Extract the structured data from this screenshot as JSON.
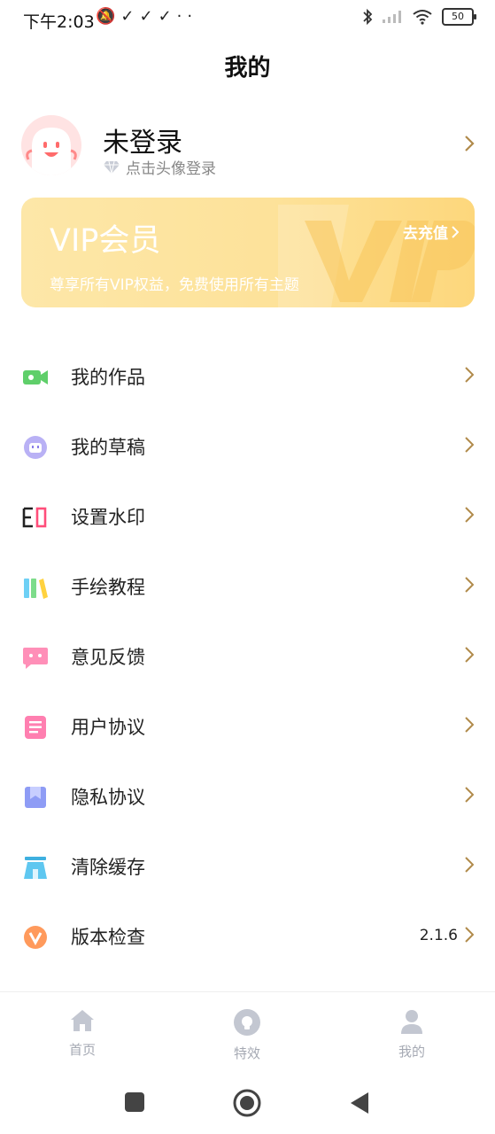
{
  "status_bar": {
    "time": "下午2:03",
    "battery": "50"
  },
  "page": {
    "title": "我的"
  },
  "profile": {
    "name": "未登录",
    "subtitle": "点击头像登录"
  },
  "vip": {
    "title": "VIP会员",
    "description": "尊享所有VIP权益，免费使用所有主题",
    "action": "去充值"
  },
  "menu": [
    {
      "label": "我的作品",
      "icon": "video-icon"
    },
    {
      "label": "我的草稿",
      "icon": "draft-icon"
    },
    {
      "label": "设置水印",
      "icon": "watermark-icon"
    },
    {
      "label": "手绘教程",
      "icon": "books-icon"
    },
    {
      "label": "意见反馈",
      "icon": "feedback-icon"
    },
    {
      "label": "用户协议",
      "icon": "document-icon"
    },
    {
      "label": "隐私协议",
      "icon": "privacy-icon"
    },
    {
      "label": "清除缓存",
      "icon": "clear-cache-icon"
    },
    {
      "label": "版本检查",
      "icon": "version-icon",
      "value": "2.1.6"
    }
  ],
  "bottom_nav": [
    {
      "label": "首页",
      "icon": "home-icon"
    },
    {
      "label": "特效",
      "icon": "effects-icon"
    },
    {
      "label": "我的",
      "icon": "profile-icon"
    }
  ],
  "colors": {
    "chevron": "#b08a4a",
    "nav_inactive": "#a5a9b3",
    "vip_gradient_start": "#fde7a8",
    "vip_gradient_end": "#fdd77c"
  }
}
